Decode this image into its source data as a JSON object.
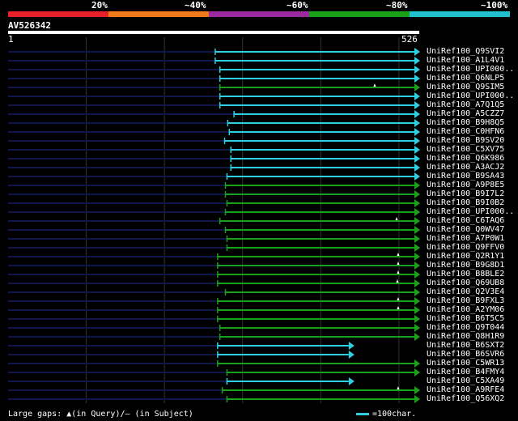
{
  "legend": {
    "colors": [
      "#e8202a",
      "#f07a1a",
      "#9b2aa0",
      "#1aa01a",
      "#20c0cc"
    ],
    "labels": [
      "20%",
      "~40%",
      "~60%",
      "~80%",
      "~100%"
    ]
  },
  "query": {
    "id": "AV526342",
    "start": "1",
    "end": "526",
    "length": 526
  },
  "hits": [
    {
      "name": "UniRef100_Q9SVI2",
      "start": 265,
      "end": 526,
      "color": "cyan",
      "gap": null
    },
    {
      "name": "UniRef100_A1L4V1",
      "start": 265,
      "end": 526,
      "color": "cyan",
      "gap": null
    },
    {
      "name": "UniRef100_UPI000..",
      "start": 271,
      "end": 526,
      "color": "cyan",
      "gap": null
    },
    {
      "name": "UniRef100_Q6NLP5",
      "start": 271,
      "end": 526,
      "color": "cyan",
      "gap": null
    },
    {
      "name": "UniRef100_Q9SIM5",
      "start": 271,
      "end": 526,
      "color": "green",
      "gap": 469
    },
    {
      "name": "UniRef100_UPI000..",
      "start": 271,
      "end": 526,
      "color": "cyan",
      "gap": null
    },
    {
      "name": "UniRef100_A7Q1Q5",
      "start": 271,
      "end": 526,
      "color": "cyan",
      "gap": null
    },
    {
      "name": "UniRef100_A5CZZ7",
      "start": 289,
      "end": 526,
      "color": "cyan",
      "gap": null
    },
    {
      "name": "UniRef100_B9H8Q5",
      "start": 281,
      "end": 526,
      "color": "cyan",
      "gap": null
    },
    {
      "name": "UniRef100_C0HFN6",
      "start": 283,
      "end": 526,
      "color": "cyan",
      "gap": null
    },
    {
      "name": "UniRef100_B9SV20",
      "start": 277,
      "end": 526,
      "color": "cyan",
      "gap": null
    },
    {
      "name": "UniRef100_C5XV75",
      "start": 285,
      "end": 526,
      "color": "cyan",
      "gap": null
    },
    {
      "name": "UniRef100_Q6K986",
      "start": 285,
      "end": 526,
      "color": "cyan",
      "gap": null
    },
    {
      "name": "UniRef100_A3ACJ2",
      "start": 285,
      "end": 526,
      "color": "cyan",
      "gap": null
    },
    {
      "name": "UniRef100_B9SA43",
      "start": 280,
      "end": 526,
      "color": "cyan",
      "gap": null
    },
    {
      "name": "UniRef100_A9P8E5",
      "start": 278,
      "end": 526,
      "color": "green",
      "gap": null
    },
    {
      "name": "UniRef100_B9I7L2",
      "start": 278,
      "end": 526,
      "color": "green",
      "gap": null
    },
    {
      "name": "UniRef100_B9I0B2",
      "start": 280,
      "end": 526,
      "color": "green",
      "gap": null
    },
    {
      "name": "UniRef100_UPI000..",
      "start": 278,
      "end": 526,
      "color": "green",
      "gap": null
    },
    {
      "name": "UniRef100_C6TAQ6",
      "start": 271,
      "end": 526,
      "color": "green",
      "gap": 497
    },
    {
      "name": "UniRef100_Q0WV47",
      "start": 278,
      "end": 526,
      "color": "green",
      "gap": null
    },
    {
      "name": "UniRef100_A7P0W1",
      "start": 280,
      "end": 526,
      "color": "green",
      "gap": null
    },
    {
      "name": "UniRef100_Q9FFV0",
      "start": 280,
      "end": 526,
      "color": "green",
      "gap": null
    },
    {
      "name": "UniRef100_Q2R1Y1",
      "start": 268,
      "end": 526,
      "color": "green",
      "gap": 499
    },
    {
      "name": "UniRef100_B9G8D1",
      "start": 268,
      "end": 526,
      "color": "green",
      "gap": 499
    },
    {
      "name": "UniRef100_B8BLE2",
      "start": 268,
      "end": 526,
      "color": "green",
      "gap": 499
    },
    {
      "name": "UniRef100_Q69UB8",
      "start": 268,
      "end": 526,
      "color": "green",
      "gap": 498
    },
    {
      "name": "UniRef100_Q2V3E4",
      "start": 278,
      "end": 526,
      "color": "green",
      "gap": null
    },
    {
      "name": "UniRef100_B9FXL3",
      "start": 268,
      "end": 526,
      "color": "green",
      "gap": 499
    },
    {
      "name": "UniRef100_A2YM06",
      "start": 268,
      "end": 526,
      "color": "green",
      "gap": 499
    },
    {
      "name": "UniRef100_B6T5C5",
      "start": 268,
      "end": 526,
      "color": "green",
      "gap": null
    },
    {
      "name": "UniRef100_Q9T044",
      "start": 271,
      "end": 526,
      "color": "green",
      "gap": null
    },
    {
      "name": "UniRef100_Q8H1R9",
      "start": 271,
      "end": 526,
      "color": "green",
      "gap": null
    },
    {
      "name": "UniRef100_B6SXT2",
      "start": 268,
      "end": 442,
      "color": "cyan",
      "gap": null
    },
    {
      "name": "UniRef100_B6SVR6",
      "start": 268,
      "end": 442,
      "color": "cyan",
      "gap": null
    },
    {
      "name": "UniRef100_C5WR13",
      "start": 268,
      "end": 526,
      "color": "green",
      "gap": null
    },
    {
      "name": "UniRef100_B4FMY4",
      "start": 280,
      "end": 526,
      "color": "green",
      "gap": null
    },
    {
      "name": "UniRef100_C5XA49",
      "start": 280,
      "end": 442,
      "color": "cyan",
      "gap": null
    },
    {
      "name": "UniRef100_A9RFE4",
      "start": 274,
      "end": 526,
      "color": "green",
      "gap": 499
    },
    {
      "name": "UniRef100_Q56XQ2",
      "start": 280,
      "end": 526,
      "color": "green",
      "gap": null
    }
  ],
  "gridlines": [
    100,
    200,
    300,
    400,
    500
  ],
  "footer": {
    "gaps_text": "Large gaps: ▲(in Query)/– (in Subject)",
    "scale_text": "=100char."
  }
}
